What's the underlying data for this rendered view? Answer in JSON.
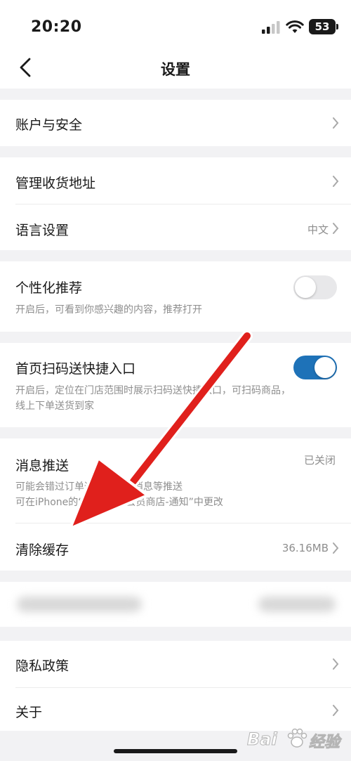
{
  "status": {
    "time": "20:20",
    "battery": "53"
  },
  "header": {
    "title": "设置"
  },
  "rows": {
    "account": {
      "title": "账户与安全"
    },
    "address": {
      "title": "管理收货地址"
    },
    "language": {
      "title": "语言设置",
      "value": "中文"
    },
    "personal": {
      "title": "个性化推荐",
      "desc": "开启后，可看到你感兴趣的内容，推荐打开",
      "enabled": false
    },
    "scan": {
      "title": "首页扫码送快捷入口",
      "desc1": "开启后，定位在门店范围时展示扫码送快捷入口，可扫码商品，",
      "desc2": "线上下单送货到家",
      "enabled": true
    },
    "push": {
      "title": "消息推送",
      "value": "已关闭",
      "desc1": "可能会错过订单通知、优惠消息等推送",
      "desc2": "可在iPhone的“设置-山姆会员商店-通知”中更改"
    },
    "cache": {
      "title": "清除缓存",
      "value": "36.16MB"
    },
    "privacy": {
      "title": "隐私政策"
    },
    "about": {
      "title": "关于"
    }
  },
  "icons": [
    "signal-icon",
    "wifi-icon",
    "battery-icon",
    "back-icon",
    "chevron-right-icon",
    "red-arrow-annotation",
    "baidu-paw-icon"
  ],
  "colors": {
    "toggle_on": "#1e72b8",
    "toggle_off": "#e8e8ea",
    "arrow": "#e0201c",
    "background": "#f2f2f4"
  },
  "watermark": {
    "brand": "Bai",
    "suffix": "经验"
  }
}
